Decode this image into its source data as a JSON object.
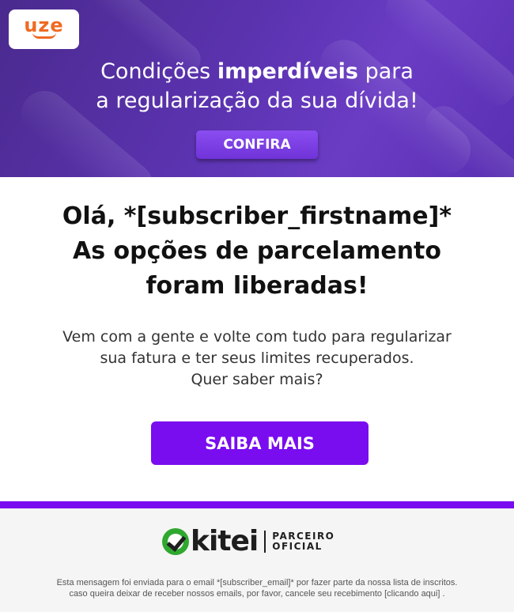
{
  "hero": {
    "logo": "uze",
    "title_regular_1": "Condições ",
    "title_bold": "imperdíveis",
    "title_regular_2": " para",
    "title_line2": "a regularização da sua dívida!",
    "cta_label": "CONFIRA"
  },
  "main": {
    "greeting": "Olá, *[subscriber_firstname]*",
    "headline_line2": "As opções de parcelamento",
    "headline_line3": "foram liberadas!",
    "body_line1": "Vem com a gente e volte com tudo para regularizar",
    "body_line2": "sua fatura e ter seus limites recuperados.",
    "body_line3": "Quer saber mais?",
    "cta_label": "SAIBA MAIS"
  },
  "footer": {
    "partner_logo": "kitei",
    "partner_line1": "PARCEIRO",
    "partner_line2": "OFICIAL",
    "disclaimer_line1": "Esta mensagem foi enviada para o email *[subscriber_email]* por fazer parte da nossa lista de inscritos.",
    "disclaimer_line2": "caso queira deixar de receber nossos emails, por favor, cancele seu recebimento [clicando aqui] ."
  },
  "colors": {
    "brand_purple": "#7a0cf0",
    "uze_orange": "#f06a22",
    "kitei_green": "#2fa82f"
  }
}
